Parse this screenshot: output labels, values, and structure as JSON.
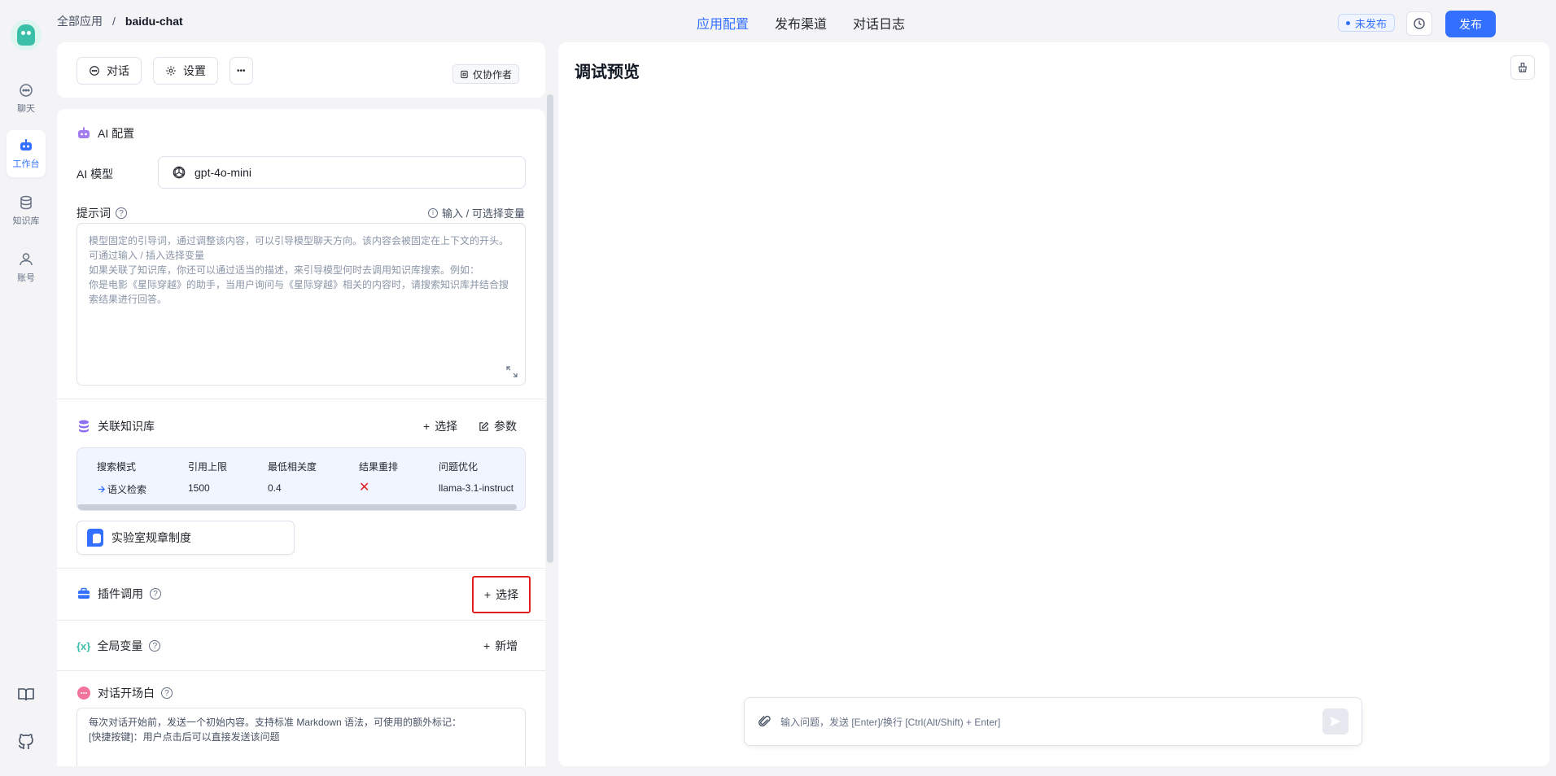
{
  "nav": {
    "items": [
      {
        "label": "聊天",
        "icon": "chat-icon"
      },
      {
        "label": "工作台",
        "icon": "robot-icon"
      },
      {
        "label": "知识库",
        "icon": "database-icon"
      },
      {
        "label": "账号",
        "icon": "user-icon"
      }
    ],
    "bottom": [
      {
        "icon": "book-icon"
      },
      {
        "icon": "github-icon"
      }
    ]
  },
  "breadcrumb": {
    "root": "全部应用",
    "sep": "/",
    "current": "baidu-chat"
  },
  "tabs": [
    "应用配置",
    "发布渠道",
    "对话日志"
  ],
  "status": {
    "unpublished": "未发布"
  },
  "publish_label": "发布",
  "toolbar": {
    "chat": "对话",
    "settings": "设置",
    "more": "•••",
    "collab": "仅协作者"
  },
  "ai": {
    "title": "AI 配置",
    "model_label": "AI 模型",
    "model_value": "gpt-4o-mini",
    "prompt_label": "提示词",
    "prompt_hint": "输入 / 可选择变量",
    "prompt_placeholder_lines": [
      "模型固定的引导词，通过调整该内容，可以引导模型聊天方向。该内容会被固定在上下文的开头。",
      "可通过输入 / 插入选择变量",
      "如果关联了知识库，你还可以通过适当的描述，来引导模型何时去调用知识库搜索。例如：",
      "你是电影《星际穿越》的助手，当用户询问与《星际穿越》相关的内容时，请搜索知识库并结合搜",
      "索结果进行回答。"
    ]
  },
  "kb": {
    "title": "关联知识库",
    "select": "选择",
    "params": "参数",
    "headers": [
      "搜索模式",
      "引用上限",
      "最低相关度",
      "结果重排",
      "问题优化"
    ],
    "row": [
      "语义检索",
      "1500",
      "0.4",
      "✕",
      "llama-3.1-instruct"
    ],
    "item": "实验室规章制度"
  },
  "plugin": {
    "title": "插件调用",
    "select": "选择"
  },
  "vars": {
    "title": "全局变量",
    "add": "新增"
  },
  "opening": {
    "title": "对话开场白",
    "lines": [
      "每次对话开始前，发送一个初始内容。支持标准 Markdown 语法，可使用的额外标记：",
      "[快捷按键]：用户点击后可以直接发送该问题"
    ]
  },
  "preview": {
    "title": "调试预览",
    "input_placeholder": "输入问题，发送 [Enter]/换行 [Ctrl(Alt/Shift) + Enter]"
  },
  "colors": {
    "accent": "#3370ff",
    "highlight": "#e02020",
    "error": "#e02020"
  }
}
